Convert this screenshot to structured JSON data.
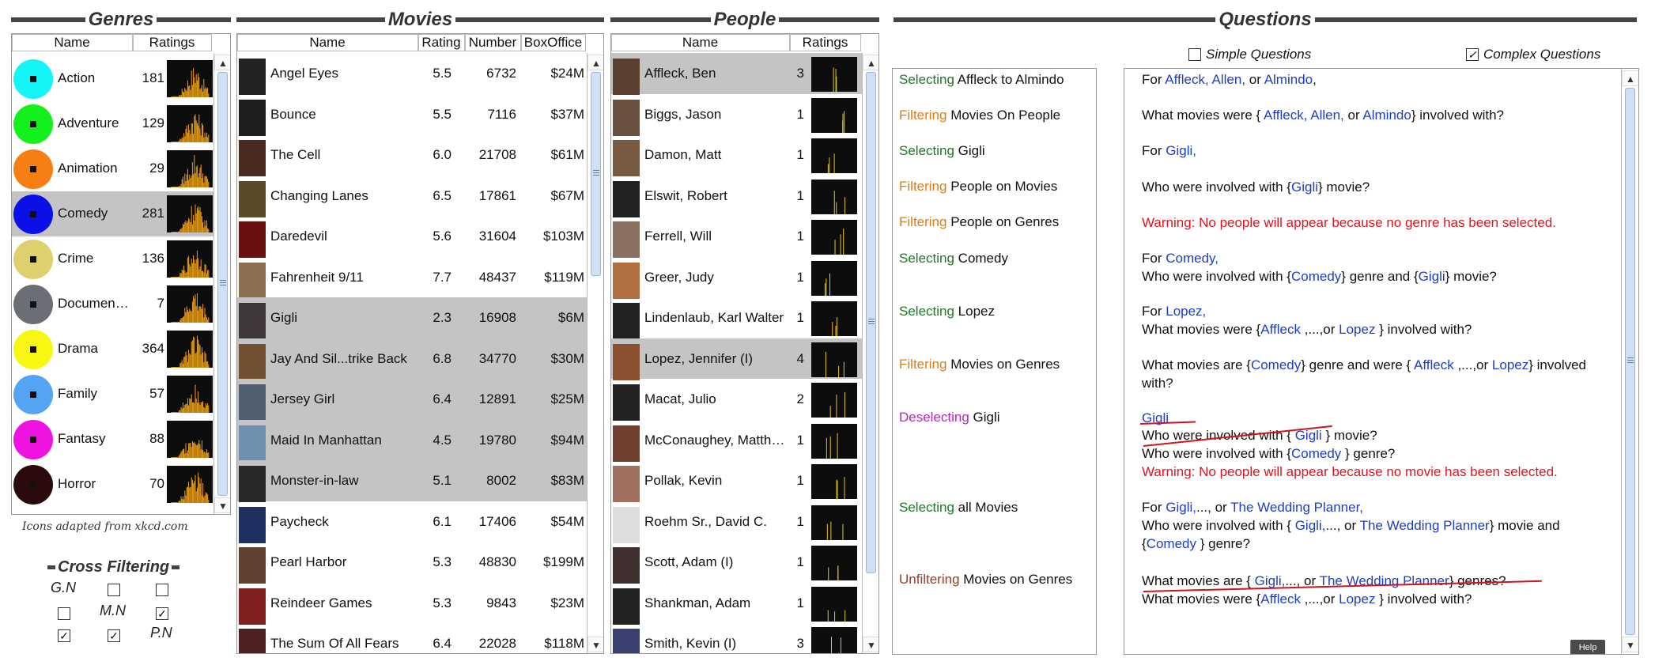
{
  "genres": {
    "title": "Genres",
    "col_name": "Name",
    "col_ratings": "Ratings",
    "items": [
      {
        "name": "Action",
        "count": "181",
        "color": "#15f5f7"
      },
      {
        "name": "Adventure",
        "count": "129",
        "color": "#14f01b"
      },
      {
        "name": "Animation",
        "count": "29",
        "color": "#f77e12"
      },
      {
        "name": "Comedy",
        "count": "281",
        "color": "#0a10e6",
        "selected": true
      },
      {
        "name": "Crime",
        "count": "136",
        "color": "#ded06f"
      },
      {
        "name": "Documen…",
        "count": "7",
        "color": "#6b6e74"
      },
      {
        "name": "Drama",
        "count": "364",
        "color": "#f7f713"
      },
      {
        "name": "Family",
        "count": "57",
        "color": "#55a4f4"
      },
      {
        "name": "Fantasy",
        "count": "88",
        "color": "#f012e0"
      },
      {
        "name": "Horror",
        "count": "70",
        "color": "#2a0a0a"
      }
    ],
    "footnote": "Icons adapted from xkcd.com"
  },
  "movies": {
    "title": "Movies",
    "col_name": "Name",
    "col_rating": "Rating",
    "col_number": "Number",
    "col_boxoffice": "BoxOffice",
    "items": [
      {
        "name": "Angel Eyes",
        "rating": "5.5",
        "number": "6732",
        "box": "$24M"
      },
      {
        "name": "Bounce",
        "rating": "5.5",
        "number": "7116",
        "box": "$37M"
      },
      {
        "name": "The Cell",
        "rating": "6.0",
        "number": "21708",
        "box": "$61M"
      },
      {
        "name": "Changing Lanes",
        "rating": "6.5",
        "number": "17861",
        "box": "$67M"
      },
      {
        "name": "Daredevil",
        "rating": "5.6",
        "number": "31604",
        "box": "$103M"
      },
      {
        "name": "Fahrenheit 9/11",
        "rating": "7.7",
        "number": "48437",
        "box": "$119M"
      },
      {
        "name": "Gigli",
        "rating": "2.3",
        "number": "16908",
        "box": "$6M",
        "selected": true
      },
      {
        "name": "Jay And Sil...trike Back",
        "rating": "6.8",
        "number": "34770",
        "box": "$30M",
        "selected": true
      },
      {
        "name": "Jersey Girl",
        "rating": "6.4",
        "number": "12891",
        "box": "$25M",
        "selected": true
      },
      {
        "name": "Maid In Manhattan",
        "rating": "4.5",
        "number": "19780",
        "box": "$94M",
        "selected": true
      },
      {
        "name": "Monster-in-law",
        "rating": "5.1",
        "number": "8002",
        "box": "$83M",
        "selected": true
      },
      {
        "name": "Paycheck",
        "rating": "6.1",
        "number": "17406",
        "box": "$54M"
      },
      {
        "name": "Pearl Harbor",
        "rating": "5.3",
        "number": "48830",
        "box": "$199M"
      },
      {
        "name": "Reindeer Games",
        "rating": "5.3",
        "number": "9843",
        "box": "$23M"
      },
      {
        "name": "The Sum Of All Fears",
        "rating": "6.4",
        "number": "22028",
        "box": "$118M"
      }
    ]
  },
  "people": {
    "title": "People",
    "col_name": "Name",
    "col_ratings": "Ratings",
    "items": [
      {
        "name": "Affleck, Ben",
        "count": "3",
        "selected": true
      },
      {
        "name": "Biggs, Jason",
        "count": "1"
      },
      {
        "name": "Damon, Matt",
        "count": "1"
      },
      {
        "name": "Elswit, Robert",
        "count": "1"
      },
      {
        "name": "Ferrell, Will",
        "count": "1"
      },
      {
        "name": "Greer, Judy",
        "count": "1"
      },
      {
        "name": "Lindenlaub, Karl Walter",
        "count": "1"
      },
      {
        "name": "Lopez, Jennifer (I)",
        "count": "4",
        "selected": true
      },
      {
        "name": "Macat, Julio",
        "count": "2"
      },
      {
        "name": "McConaughey, Matth…",
        "count": "1"
      },
      {
        "name": "Pollak, Kevin",
        "count": "1"
      },
      {
        "name": "Roehm Sr., David C.",
        "count": "1"
      },
      {
        "name": "Scott, Adam (I)",
        "count": "1"
      },
      {
        "name": "Shankman, Adam",
        "count": "1"
      },
      {
        "name": "Smith, Kevin (I)",
        "count": "3"
      }
    ]
  },
  "cross_filtering": {
    "title": "Cross Filtering",
    "gn": "G.N",
    "mn": "M.N",
    "pn": "P.N"
  },
  "questions": {
    "title": "Questions",
    "simple_label": "Simple Questions",
    "complex_label": "Complex Questions",
    "help": "Help",
    "steps": [
      {
        "verb": "Selecting",
        "rest": " Affleck to Almindo",
        "color": "green"
      },
      {
        "verb": "Filtering",
        "rest": " Movies On People",
        "color": "orange"
      },
      {
        "verb": "Selecting",
        "rest": " Gigli",
        "color": "green"
      },
      {
        "verb": "Filtering",
        "rest": " People on Movies",
        "color": "orange"
      },
      {
        "verb": "Filtering",
        "rest": " People on Genres",
        "color": "orange"
      },
      {
        "verb": "Selecting",
        "rest": " Comedy",
        "color": "green"
      },
      {
        "verb": "Selecting",
        "rest": " Lopez",
        "color": "green"
      },
      {
        "verb": "Filtering",
        "rest": " Movies on Genres",
        "color": "orange"
      },
      {
        "verb": "Deselecting",
        "rest": " Gigli",
        "color": "purple"
      },
      {
        "verb": "Selecting",
        "rest": " all Movies",
        "color": "green"
      },
      {
        "verb": "Unfiltering",
        "rest": " Movies on Genres",
        "color": "brown"
      }
    ],
    "answers": {
      "a1_pre": "For ",
      "a1_n1": "Affleck,",
      "a1_n2": "Allen,",
      "a1_or": " or ",
      "a1_n3": "Almindo",
      "a1_end": ",",
      "a2_pre": "What movies were { ",
      "a2_n1": "Affleck,",
      "a2_n2": "Allen,",
      "a2_or": " or ",
      "a2_n3": "Almindo",
      "a2_end": "} involved with?",
      "a3_pre": "For ",
      "a3_n": "Gigli,",
      "a4_pre": "Who were involved with {",
      "a4_n": "Gigli",
      "a4_end": "} movie?",
      "a5_warn": "Warning: No people will appear because no genre has been selected.",
      "a6_pre": "For ",
      "a6_n": "Comedy,",
      "a6b_pre": "Who were involved with {",
      "a6b_n1": "Comedy",
      "a6b_mid": "} genre and {",
      "a6b_n2": "Gigli",
      "a6b_end": "} movie?",
      "a7_pre": "For ",
      "a7_n": "Lopez,",
      "a7b_pre": "What movies were {",
      "a7b_n1": "Affleck",
      "a7b_mid": " ,...,or ",
      "a7b_n2": "Lopez",
      "a7b_end": " } involved with?",
      "a8_pre": "What movies are {",
      "a8_n1": "Comedy",
      "a8_mid": "} genre and were { ",
      "a8_n2": "Affleck",
      "a8_mid2": " ,...,or ",
      "a8_n3": "Lopez",
      "a8_end": "} involved",
      "a8b": "with?",
      "a9_n": "Gigli",
      "a9b_pre": "Who were involved with { ",
      "a9b_n": "Gigli",
      "a9b_end": " } movie?",
      "a9c_pre": "Who were involved with {",
      "a9c_n": "Comedy",
      "a9c_end": " } genre?",
      "a9_warn": "Warning: No people will appear because no movie has been selected.",
      "a10_pre": "For ",
      "a10_n1": "Gigli,",
      "a10_mid": "..., or ",
      "a10_n2": "The Wedding Planner,",
      "a10b_pre": "Who were involved with { ",
      "a10b_n1": "Gigli,",
      "a10b_mid": "..., or ",
      "a10b_n2": "The Wedding Planner",
      "a10b_end": "} movie and",
      "a10c_pre": "{",
      "a10c_n": "Comedy",
      "a10c_end": " } genre?",
      "a11_pre": "What movies are { ",
      "a11_n1": "Gigli,",
      "a11_mid": "..., or ",
      "a11_n2": "The Wedding Planner",
      "a11_end": "} genres?",
      "a11b_pre": "What movies were {",
      "a11b_n1": "Affleck",
      "a11b_mid": " ,...,or ",
      "a11b_n2": "Lopez",
      "a11b_end": " } involved with?"
    }
  },
  "colors": {
    "selected_row": "#c4c4c4",
    "link_blue": "#1c3ec6",
    "warning_red": "#e0141e",
    "select_green": "#1c7a23",
    "filter_orange": "#e07b12",
    "deselect_purple": "#b228b8",
    "unfilter_brown": "#9a3c1e"
  }
}
